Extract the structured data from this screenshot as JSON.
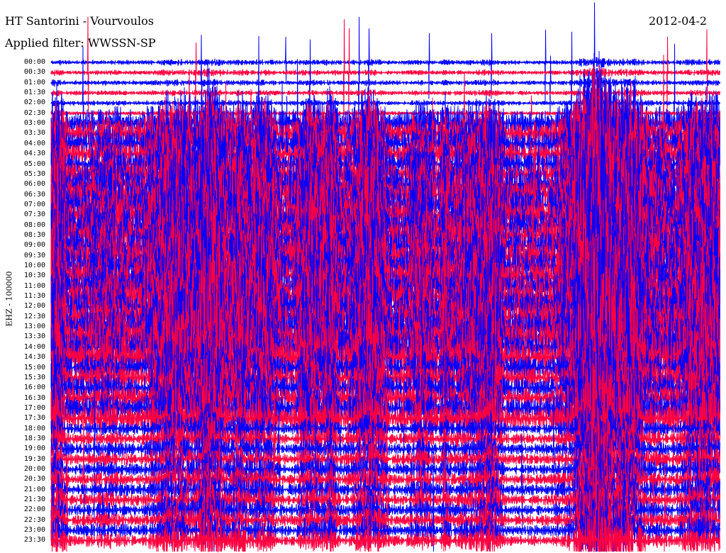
{
  "header": {
    "title": "HT Santorini - Vourvoulos",
    "filter": "Applied filter: WWSSN-SP",
    "date": "2012-04-2"
  },
  "chart_data": {
    "type": "line",
    "title": "HT Santorini - Vourvoulos",
    "subtitle": "Applied filter: WWSSN-SP",
    "ylabel": "EHZ - 100000",
    "xlabel": "",
    "row_labels": [
      "00:00",
      "00:30",
      "01:00",
      "01:30",
      "02:00",
      "02:30",
      "03:00",
      "03:30",
      "04:00",
      "04:30",
      "05:00",
      "05:30",
      "06:00",
      "06:30",
      "07:00",
      "07:30",
      "08:00",
      "08:30",
      "09:00",
      "09:30",
      "10:00",
      "10:30",
      "11:00",
      "11:30",
      "12:00",
      "12:30",
      "13:00",
      "13:30",
      "14:00",
      "14:30",
      "15:00",
      "15:30",
      "16:00",
      "16:30",
      "17:00",
      "17:30",
      "18:00",
      "18:30",
      "19:00",
      "19:30",
      "20:00",
      "20:30",
      "21:00",
      "21:30",
      "22:00",
      "22:30",
      "23:00",
      "23:30"
    ],
    "series_colors": [
      "#0000ff",
      "#ff0040"
    ],
    "grid": false
  }
}
